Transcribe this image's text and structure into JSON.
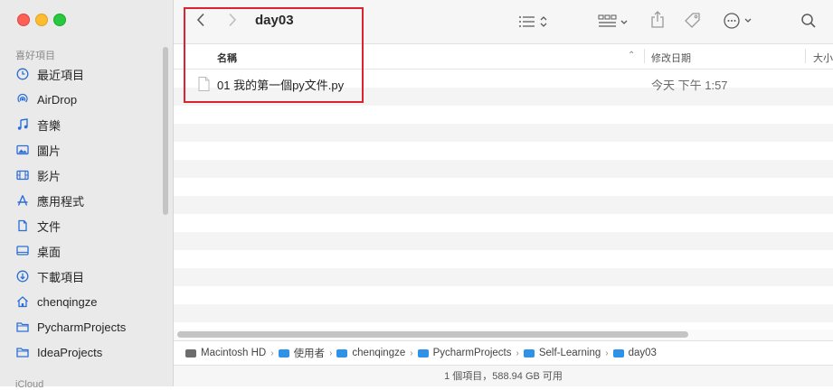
{
  "window": {
    "title": "day03"
  },
  "sidebar": {
    "favorites_title": "喜好項目",
    "icloud_title": "iCloud",
    "items": [
      {
        "label": "最近項目",
        "icon": "clock-icon"
      },
      {
        "label": "AirDrop",
        "icon": "airdrop-icon"
      },
      {
        "label": "音樂",
        "icon": "music-icon"
      },
      {
        "label": "圖片",
        "icon": "photo-icon"
      },
      {
        "label": "影片",
        "icon": "film-icon"
      },
      {
        "label": "應用程式",
        "icon": "apps-icon"
      },
      {
        "label": "文件",
        "icon": "document-icon"
      },
      {
        "label": "桌面",
        "icon": "desktop-icon"
      },
      {
        "label": "下載項目",
        "icon": "download-icon"
      },
      {
        "label": "chenqingze",
        "icon": "home-icon"
      },
      {
        "label": "PycharmProjects",
        "icon": "folder-icon"
      },
      {
        "label": "IdeaProjects",
        "icon": "folder-icon"
      }
    ]
  },
  "columns": {
    "name": "名稱",
    "date": "修改日期",
    "size": "大小"
  },
  "files": [
    {
      "name": "01 我的第一個py文件.py",
      "date": "今天 下午 1:57"
    }
  ],
  "pathbar": [
    "Macintosh HD",
    "使用者",
    "chenqingze",
    "PycharmProjects",
    "Self-Learning",
    "day03"
  ],
  "status": "1 個項目，588.94 GB 可用",
  "colors": {
    "accent": "#2b6fd6",
    "highlight": "#d8262c"
  }
}
